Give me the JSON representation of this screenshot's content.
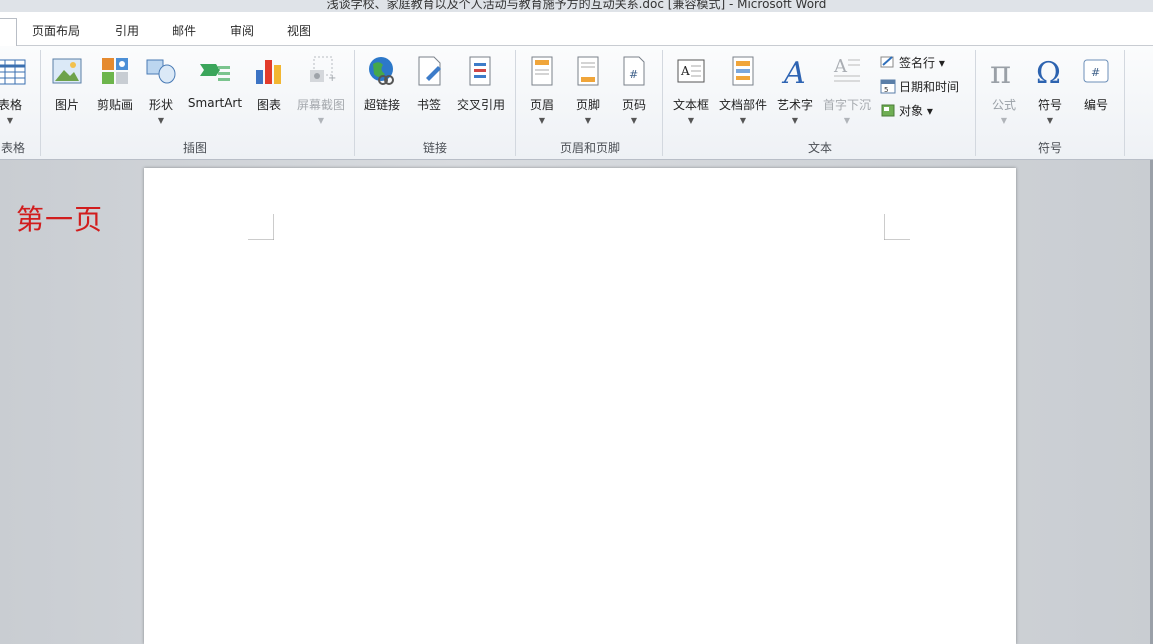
{
  "window": {
    "title": "浅谈学校、家庭教育以及个人活动与教育施予方的互动关系.doc [兼容模式] - Microsoft Word"
  },
  "tabs": [
    "页面布局",
    "引用",
    "邮件",
    "审阅",
    "视图"
  ],
  "ribbon": {
    "table": {
      "button": "表格",
      "group": "表格"
    },
    "illustrations": {
      "group": "插图",
      "buttons": [
        "图片",
        "剪贴画",
        "形状",
        "SmartArt",
        "图表",
        "屏幕截图"
      ]
    },
    "links": {
      "group": "链接",
      "buttons": [
        "超链接",
        "书签",
        "交叉引用"
      ]
    },
    "header_footer": {
      "group": "页眉和页脚",
      "buttons": [
        "页眉",
        "页脚",
        "页码"
      ]
    },
    "text": {
      "group": "文本",
      "buttons": [
        "文本框",
        "文档部件",
        "艺术字",
        "首字下沉"
      ],
      "small_buttons": [
        "签名行 ▾",
        "日期和时间",
        "对象 ▾"
      ]
    },
    "symbols": {
      "group": "符号",
      "buttons": [
        "公式",
        "符号",
        "编号"
      ]
    }
  },
  "document": {
    "annotation": "第一页"
  },
  "colors": {
    "annotation": "#d11d1d",
    "ribbon_bg": "#f4f6f9",
    "workspace_bg": "#c9cdd2"
  }
}
